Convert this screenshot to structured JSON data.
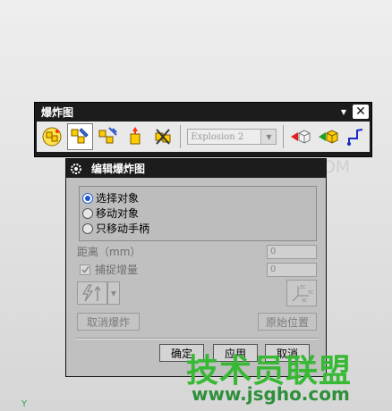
{
  "toolbar": {
    "title": "爆炸图",
    "explosion_select": "Explosion 2",
    "close_symbol": "✕"
  },
  "dialog": {
    "title": "编辑爆炸图",
    "radios": [
      {
        "label": "选择对象",
        "selected": true
      },
      {
        "label": "移动对象",
        "selected": false
      },
      {
        "label": "只移动手柄",
        "selected": false
      }
    ],
    "distance_label": "距离（mm）",
    "distance_value": "0",
    "snap_label": "捕捉增量",
    "snap_value": "0",
    "cancel_explode": "取消爆炸",
    "original_position": "原始位置",
    "axis_labels": {
      "zc": "ZC",
      "yc": "YC",
      "xc": "XC"
    },
    "ok": "确定",
    "apply": "应用",
    "cancel": "取消"
  },
  "watermarks": {
    "brand_top": "三联网 3LIAN.COM",
    "brand_bottom": "技术员联盟",
    "url": "www.jsgho.com"
  },
  "viewport": {
    "axis_label": "Y"
  },
  "colors": {
    "titlebar": "#1c1c1c",
    "dialog_bg": "#c0c0c0",
    "radio_selected": "#1a56d6",
    "watermark_green": "#37b935"
  }
}
